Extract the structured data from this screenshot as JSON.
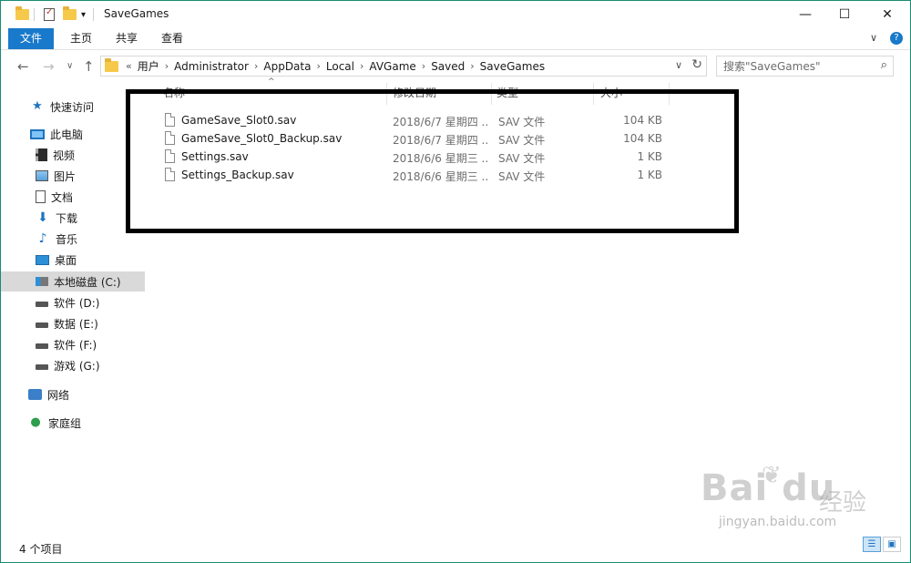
{
  "window": {
    "title": "SaveGames",
    "minimize_glyph": "—",
    "maximize_glyph": "☐",
    "close_glyph": "✕"
  },
  "ribbon": {
    "tabs": [
      "文件",
      "主页",
      "共享",
      "查看"
    ],
    "collapse_glyph": "∨",
    "help_glyph": "?"
  },
  "nav": {
    "back": "←",
    "forward": "→",
    "recent": "∨",
    "up": "↑",
    "overflow": "«",
    "breadcrumbs": [
      "用户",
      "Administrator",
      "AppData",
      "Local",
      "AVGame",
      "Saved",
      "SaveGames"
    ],
    "crumb_sep": "›",
    "dropdown_glyph": "∨",
    "refresh_glyph": "↻"
  },
  "search": {
    "placeholder": "搜索\"SaveGames\"",
    "icon": "search-icon"
  },
  "sidebar": {
    "items": [
      {
        "label": "快速访问",
        "icon": "star-icon"
      },
      {
        "label": "此电脑",
        "icon": "computer-icon"
      },
      {
        "label": "视频",
        "icon": "video-icon"
      },
      {
        "label": "图片",
        "icon": "picture-icon"
      },
      {
        "label": "文档",
        "icon": "document-icon"
      },
      {
        "label": "下载",
        "icon": "download-icon"
      },
      {
        "label": "音乐",
        "icon": "music-icon"
      },
      {
        "label": "桌面",
        "icon": "desktop-icon"
      },
      {
        "label": "本地磁盘 (C:)",
        "icon": "system-drive-icon",
        "selected": true
      },
      {
        "label": "软件 (D:)",
        "icon": "drive-icon"
      },
      {
        "label": "数据 (E:)",
        "icon": "drive-icon"
      },
      {
        "label": "软件 (F:)",
        "icon": "drive-icon"
      },
      {
        "label": "游戏 (G:)",
        "icon": "drive-icon"
      },
      {
        "label": "网络",
        "icon": "network-icon"
      },
      {
        "label": "家庭组",
        "icon": "homegroup-icon"
      }
    ]
  },
  "file_list": {
    "columns": [
      "名称",
      "修改日期",
      "类型",
      "大小"
    ],
    "rows": [
      {
        "name": "GameSave_Slot0.sav",
        "date": "2018/6/7 星期四 ...",
        "type": "SAV 文件",
        "size": "104 KB"
      },
      {
        "name": "GameSave_Slot0_Backup.sav",
        "date": "2018/6/7 星期四 ...",
        "type": "SAV 文件",
        "size": "104 KB"
      },
      {
        "name": "Settings.sav",
        "date": "2018/6/6 星期三 ...",
        "type": "SAV 文件",
        "size": "1 KB"
      },
      {
        "name": "Settings_Backup.sav",
        "date": "2018/6/6 星期三 ...",
        "type": "SAV 文件",
        "size": "1 KB"
      }
    ]
  },
  "status": {
    "item_count": "4 个项目"
  },
  "watermark": {
    "logo": "Bai du",
    "cn": "经验",
    "url": "jingyan.baidu.com"
  },
  "colors": {
    "accent": "#1979ca",
    "window_border": "#1a8b73",
    "selected": "#d9d9d9",
    "annotation_box": "#000000"
  }
}
